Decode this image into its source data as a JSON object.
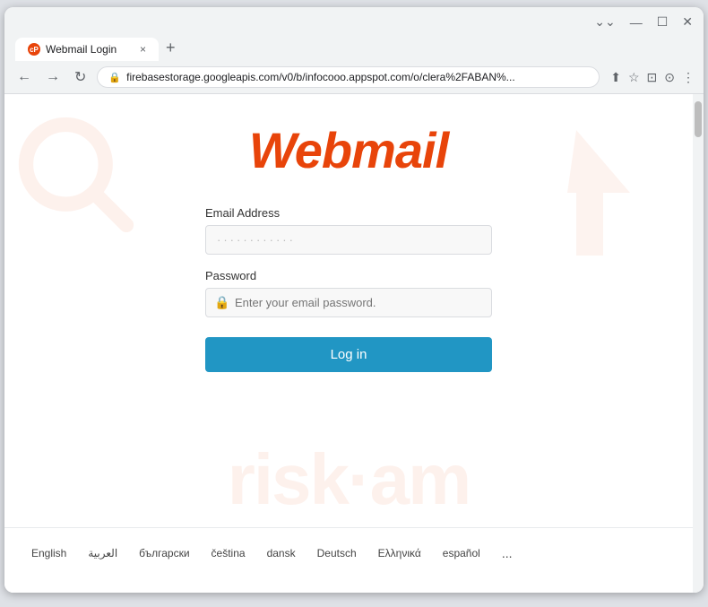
{
  "browser": {
    "title": "Webmail Login",
    "url": "firebasestorage.googleapis.com/v0/b/infocooo.appspot.com/o/clera%2FABAN%...",
    "favicon_label": "cP",
    "tab_close_label": "×",
    "new_tab_label": "+"
  },
  "nav": {
    "back_label": "←",
    "forward_label": "→",
    "reload_label": "↻"
  },
  "page": {
    "logo": "Webmail",
    "email_label": "Email Address",
    "email_placeholder": "············",
    "password_label": "Password",
    "password_placeholder": "Enter your email password.",
    "login_button": "Log in",
    "watermark_text": "risk·am"
  },
  "languages": [
    {
      "label": "English"
    },
    {
      "label": "العربية"
    },
    {
      "label": "български"
    },
    {
      "label": "čeština"
    },
    {
      "label": "dansk"
    },
    {
      "label": "Deutsch"
    },
    {
      "label": "Ελληνικά"
    },
    {
      "label": "español"
    },
    {
      "label": "..."
    }
  ],
  "window_controls": {
    "chevron_up": "⌃",
    "minimize": "—",
    "maximize": "☐",
    "close": "✕"
  }
}
